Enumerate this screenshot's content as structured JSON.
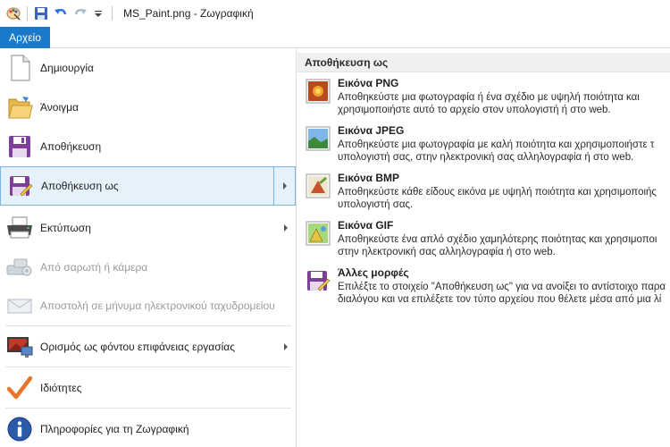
{
  "titlebar": {
    "title": "MS_Paint.png - Ζωγραφική",
    "icons": [
      "paint-app-icon",
      "save-icon",
      "undo-icon",
      "redo-icon",
      "customize-qat-icon"
    ]
  },
  "file_tab": {
    "label": "Αρχείο"
  },
  "menu": {
    "items": [
      {
        "label": "Δημιουργία",
        "icon": "new-document-icon",
        "enabled": true
      },
      {
        "label": "Άνοιγμα",
        "icon": "open-folder-icon",
        "enabled": true
      },
      {
        "label": "Αποθήκευση",
        "icon": "save-icon",
        "enabled": true
      },
      {
        "label": "Αποθήκευση ως",
        "icon": "save-as-icon",
        "enabled": true,
        "submenu": true,
        "selected": true
      },
      {
        "label": "Εκτύπωση",
        "icon": "printer-icon",
        "enabled": true,
        "submenu": true
      },
      {
        "label": "Από σαρωτή ή κάμερα",
        "icon": "scanner-camera-icon",
        "enabled": false
      },
      {
        "label": "Αποστολή σε μήνυμα ηλεκτρονικού ταχυδρομείου",
        "icon": "email-icon",
        "enabled": false
      },
      {
        "label": "Ορισμός ως φόντου επιφάνειας εργασίας",
        "icon": "desktop-background-icon",
        "enabled": true,
        "submenu": true
      },
      {
        "label": "Ιδιότητες",
        "icon": "checkmark-icon",
        "enabled": true
      },
      {
        "label": "Πληροφορίες για τη Ζωγραφική",
        "icon": "info-icon",
        "enabled": true
      }
    ]
  },
  "save_as_panel": {
    "header": "Αποθήκευση ως",
    "options": [
      {
        "title": "Εικόνα PNG",
        "icon": "png-image-icon",
        "desc1": "Αποθηκεύστε μια φωτογραφία ή ένα σχέδιο με υψηλή ποιότητα και",
        "desc2": "χρησιμοποιήστε αυτό το αρχείο στον υπολογιστή ή στο web."
      },
      {
        "title": "Εικόνα JPEG",
        "icon": "jpeg-image-icon",
        "desc1": "Αποθηκεύστε μια φωτογραφία με καλή ποιότητα και χρησιμοποιήστε τ",
        "desc2": "υπολογιστή σας, στην ηλεκτρονική σας αλληλογραφία ή στο web."
      },
      {
        "title": "Εικόνα BMP",
        "icon": "bmp-image-icon",
        "desc1": "Αποθηκεύστε κάθε είδους εικόνα με υψηλή ποιότητα και χρησιμοποιής",
        "desc2": "υπολογιστή σας."
      },
      {
        "title": "Εικόνα GIF",
        "icon": "gif-image-icon",
        "desc1": "Αποθηκεύστε ένα απλό σχέδιο χαμηλότερης ποιότητας και χρησιμοποι",
        "desc2": "στην ηλεκτρονική σας αλληλογραφία ή στο web."
      },
      {
        "title": "Άλλες μορφές",
        "icon": "other-formats-icon",
        "desc1": "Επιλέξτε το στοιχείο \"Αποθήκευση ως\" για να ανοίξει το αντίστοιχο παρα",
        "desc2": "διαλόγου και να επιλέξετε τον τύπο αρχείου που θέλετε μέσα από μια λί"
      }
    ]
  },
  "colors": {
    "accent": "#1979ca",
    "selection": "#e5f1fb",
    "selection_border": "#7fb5e2"
  }
}
